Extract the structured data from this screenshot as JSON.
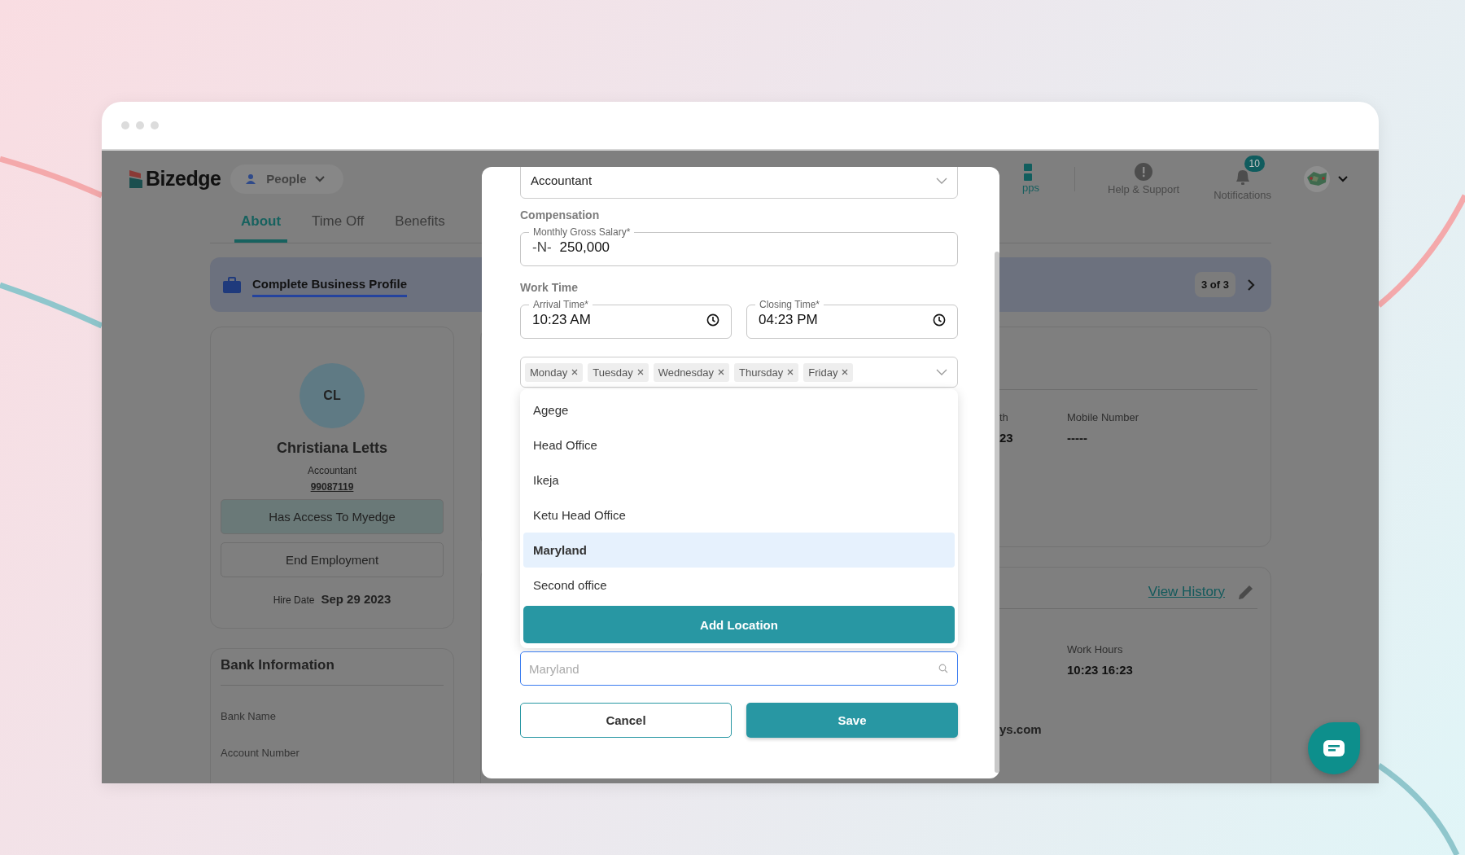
{
  "header": {
    "logo": "Bizedge",
    "module": "People",
    "apps_label": "pps",
    "help": "Help & Support",
    "notifications": {
      "label": "Notifications",
      "count": "10"
    }
  },
  "tabs": [
    {
      "label": "About",
      "selected": true
    },
    {
      "label": "Time Off",
      "selected": false
    },
    {
      "label": "Benefits",
      "selected": false
    }
  ],
  "banner": {
    "title": "Complete Business Profile",
    "step": "3 of 3"
  },
  "profile": {
    "initials": "CL",
    "name": "Christiana Letts",
    "role": "Accountant",
    "employee_id": "99087119",
    "access_button": "Has Access To Myedge",
    "end_button": "End Employment",
    "hire_date_label": "Hire Date",
    "hire_date": "Sep 29 2023"
  },
  "bank": {
    "title": "Bank Information",
    "fields": [
      "Bank Name",
      "Account Number"
    ]
  },
  "details": {
    "fields": [
      {
        "label": "th",
        "value": "23"
      },
      {
        "label": "Mobile Number",
        "value": "-----"
      }
    ]
  },
  "work": {
    "link": "View History",
    "fields": [
      {
        "label": "Work Hours",
        "value": "10:23 16:23"
      }
    ],
    "email_fragment": "ys.com"
  },
  "modal": {
    "job_title": "Accountant",
    "compensation_heading": "Compensation",
    "salary": {
      "label": "Monthly Gross Salary*",
      "prefix": "-N-",
      "value": "250,000"
    },
    "work_time_heading": "Work Time",
    "arrival": {
      "label": "Arrival Time*",
      "value": "10:23 AM"
    },
    "closing": {
      "label": "Closing Time*",
      "value": "04:23 PM"
    },
    "work_days": [
      "Monday",
      "Tuesday",
      "Wednesday",
      "Thursday",
      "Friday"
    ],
    "location": {
      "placeholder": "Maryland",
      "add_button": "Add Location",
      "options": [
        {
          "label": "Agege",
          "selected": false
        },
        {
          "label": "Head Office",
          "selected": false
        },
        {
          "label": "Ikeja",
          "selected": false
        },
        {
          "label": "Ketu Head Office",
          "selected": false
        },
        {
          "label": "Maryland",
          "selected": true
        },
        {
          "label": "Second office",
          "selected": false
        }
      ]
    },
    "cancel": "Cancel",
    "save": "Save"
  }
}
